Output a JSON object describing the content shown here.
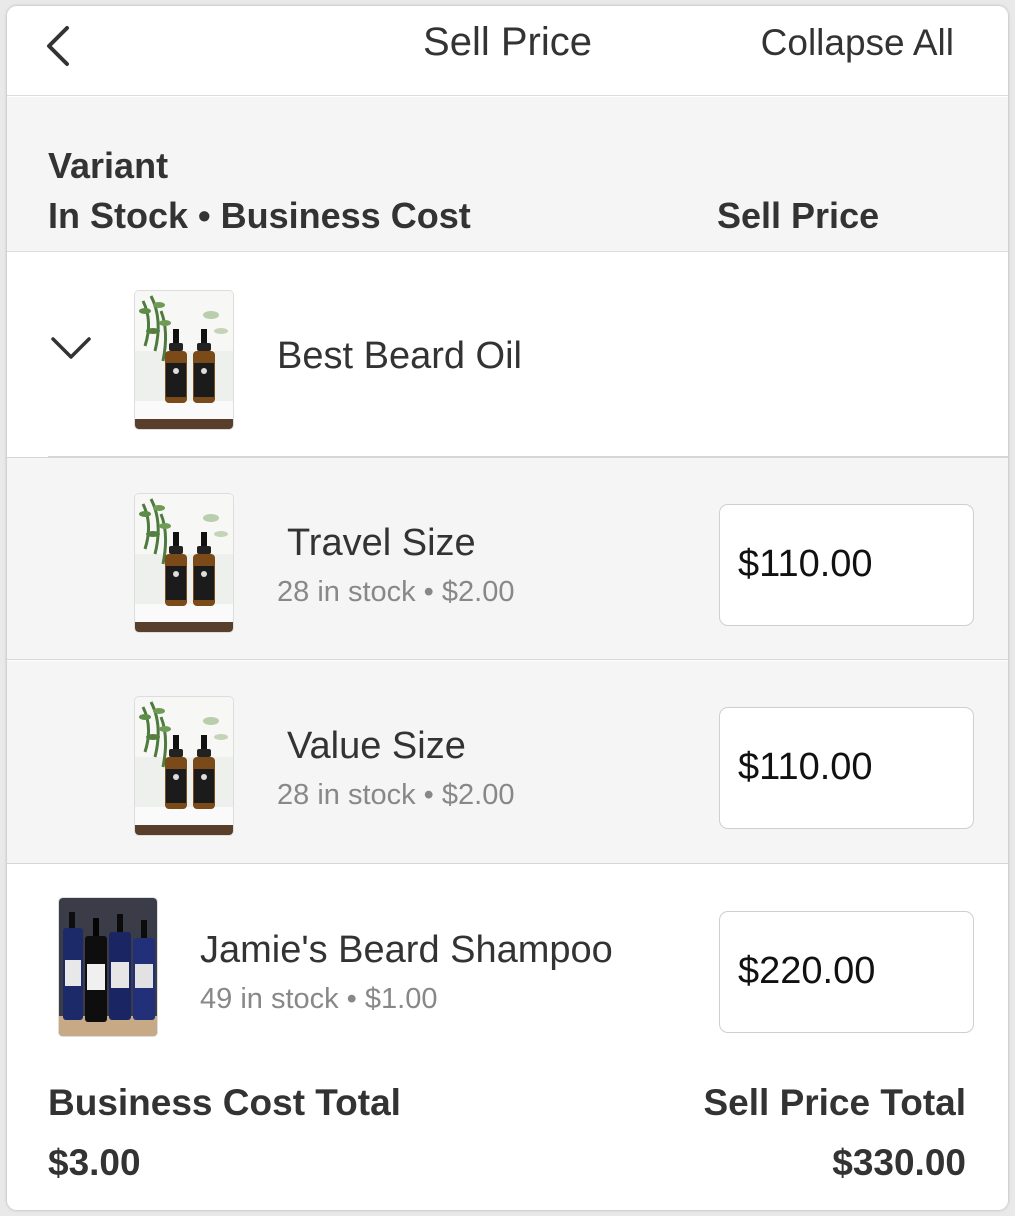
{
  "header": {
    "title": "Sell Price",
    "collapse_all_label": "Collapse All"
  },
  "columns": {
    "variant": "Variant",
    "stock_cost": "In Stock • Business Cost",
    "sell_price": "Sell Price"
  },
  "parent_product": {
    "name": "Best Beard Oil",
    "variants": [
      {
        "name": "Travel Size",
        "meta": "28 in stock • $2.00",
        "price": "$110.00"
      },
      {
        "name": "Value Size",
        "meta": "28 in stock • $2.00",
        "price": "$110.00"
      }
    ]
  },
  "product": {
    "name": "Jamie's Beard Shampoo",
    "meta": "49 in stock • $1.00",
    "price": "$220.00"
  },
  "totals": {
    "business_cost_label": "Business Cost Total",
    "business_cost_value": "$3.00",
    "sell_price_label": "Sell Price Total",
    "sell_price_value": "$330.00"
  },
  "icons": {
    "back": "back-chevron-icon",
    "expand": "chevron-down-icon"
  },
  "colors": {
    "text": "#333333",
    "muted": "#888888",
    "band": "#f5f5f5",
    "divider": "#dcdcdc"
  }
}
